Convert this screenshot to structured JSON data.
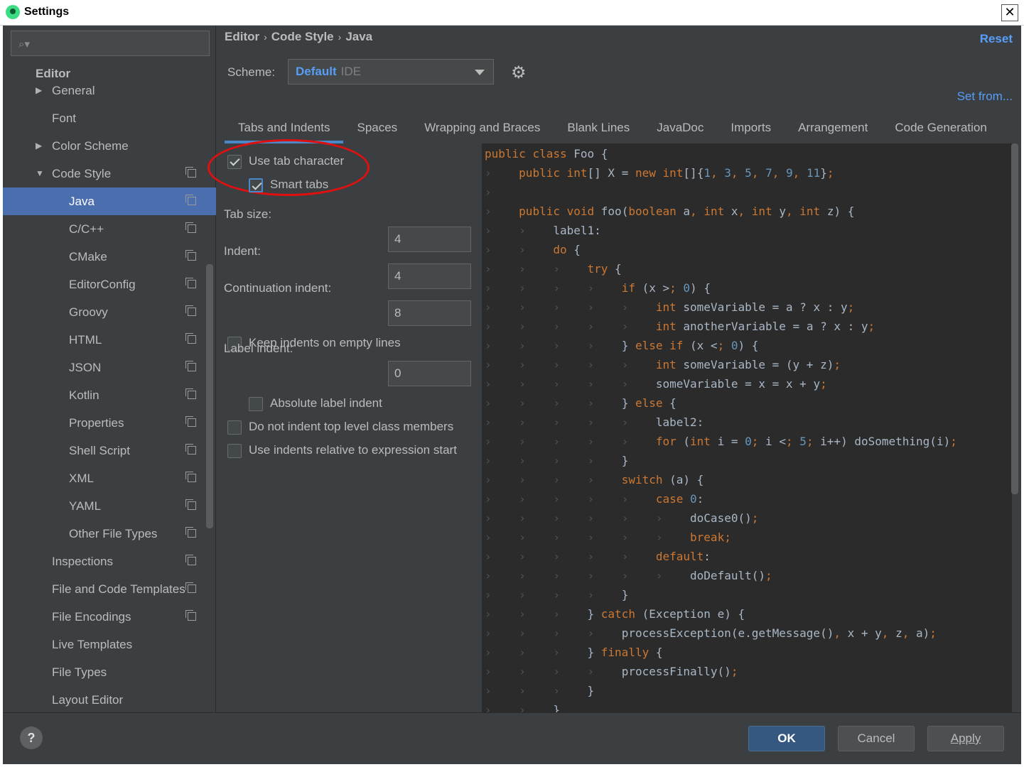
{
  "window": {
    "title": "Settings",
    "close_glyph": "✕"
  },
  "sidebar": {
    "search_placeholder": "",
    "section_title": "Editor",
    "items": [
      {
        "label": "General",
        "arrow": "▶"
      },
      {
        "label": "Font"
      },
      {
        "label": "Color Scheme",
        "arrow": "▶"
      },
      {
        "label": "Code Style",
        "arrow": "▼"
      },
      {
        "label": "Java",
        "selected": true
      },
      {
        "label": "C/C++"
      },
      {
        "label": "CMake"
      },
      {
        "label": "EditorConfig"
      },
      {
        "label": "Groovy"
      },
      {
        "label": "HTML"
      },
      {
        "label": "JSON"
      },
      {
        "label": "Kotlin"
      },
      {
        "label": "Properties"
      },
      {
        "label": "Shell Script"
      },
      {
        "label": "XML"
      },
      {
        "label": "YAML"
      },
      {
        "label": "Other File Types"
      },
      {
        "label": "Inspections"
      },
      {
        "label": "File and Code Templates"
      },
      {
        "label": "File Encodings"
      },
      {
        "label": "Live Templates"
      },
      {
        "label": "File Types"
      },
      {
        "label": "Layout Editor"
      }
    ]
  },
  "header": {
    "breadcrumb": [
      "Editor",
      "Code Style",
      "Java"
    ],
    "breadcrumb_sep": "›",
    "reset_label": "Reset",
    "scheme_label": "Scheme:",
    "scheme_name": "Default",
    "scheme_kind": "IDE",
    "set_from_label": "Set from..."
  },
  "tabs": [
    "Tabs and Indents",
    "Spaces",
    "Wrapping and Braces",
    "Blank Lines",
    "JavaDoc",
    "Imports",
    "Arrangement",
    "Code Generation"
  ],
  "options": {
    "use_tab_character": {
      "label": "Use tab character",
      "checked": true
    },
    "smart_tabs": {
      "label": "Smart tabs",
      "checked": true
    },
    "tab_size_label": "Tab size:",
    "tab_size": "4",
    "indent_label": "Indent:",
    "indent": "4",
    "continuation_label": "Continuation indent:",
    "continuation": "8",
    "keep_indents": {
      "label": "Keep indents on empty lines",
      "checked": false
    },
    "label_indent_label": "Label indent:",
    "label_indent": "0",
    "absolute_label_indent": {
      "label": "Absolute label indent",
      "checked": false
    },
    "no_indent_top_level": {
      "label": "Do not indent top level class members",
      "checked": false
    },
    "relative_to_expression": {
      "label": "Use indents relative to expression start",
      "checked": false
    }
  },
  "code": {
    "tab_mark": "›",
    "lines": [
      {
        "indent": 0,
        "text": "public class Foo {"
      },
      {
        "indent": 1,
        "text": "public int[] X = new int[]{1, 3, 5, 7, 9, 11};"
      },
      {
        "indent": 0,
        "text": ""
      },
      {
        "indent": 1,
        "text": "public void foo(boolean a, int x, int y, int z) {"
      },
      {
        "indent": 2,
        "text": "label1:"
      },
      {
        "indent": 2,
        "text": "do {"
      },
      {
        "indent": 3,
        "text": "try {"
      },
      {
        "indent": 4,
        "text": "if (x > 0) {"
      },
      {
        "indent": 5,
        "text": "int someVariable = a ? x : y;"
      },
      {
        "indent": 5,
        "text": "int anotherVariable = a ? x : y;"
      },
      {
        "indent": 4,
        "text": "} else if (x < 0) {"
      },
      {
        "indent": 5,
        "text": "int someVariable = (y + z);"
      },
      {
        "indent": 5,
        "text": "someVariable = x = x + y;"
      },
      {
        "indent": 4,
        "text": "} else {"
      },
      {
        "indent": 5,
        "text": "label2:"
      },
      {
        "indent": 5,
        "text": "for (int i = 0; i < 5; i++) doSomething(i);"
      },
      {
        "indent": 4,
        "text": "}"
      },
      {
        "indent": 4,
        "text": "switch (a) {"
      },
      {
        "indent": 5,
        "text": "case 0:"
      },
      {
        "indent": 6,
        "text": "doCase0();"
      },
      {
        "indent": 6,
        "text": "break;"
      },
      {
        "indent": 5,
        "text": "default:"
      },
      {
        "indent": 6,
        "text": "doDefault();"
      },
      {
        "indent": 4,
        "text": "}"
      },
      {
        "indent": 3,
        "text": "} catch (Exception e) {"
      },
      {
        "indent": 4,
        "text": "processException(e.getMessage(), x + y, z, a);"
      },
      {
        "indent": 3,
        "text": "} finally {"
      },
      {
        "indent": 4,
        "text": "processFinally();"
      },
      {
        "indent": 3,
        "text": "}"
      },
      {
        "indent": 2,
        "text": "}"
      }
    ]
  },
  "footer": {
    "help_label": "?",
    "ok_label": "OK",
    "cancel_label": "Cancel",
    "apply_label": "Apply"
  },
  "colors": {
    "background": "#3c3f41",
    "editor_background": "#2b2b2b",
    "selection": "#4b6eaf",
    "link": "#589df6",
    "keyword": "#cc7832",
    "number": "#6897bb",
    "annotation_circle": "#e01010"
  }
}
